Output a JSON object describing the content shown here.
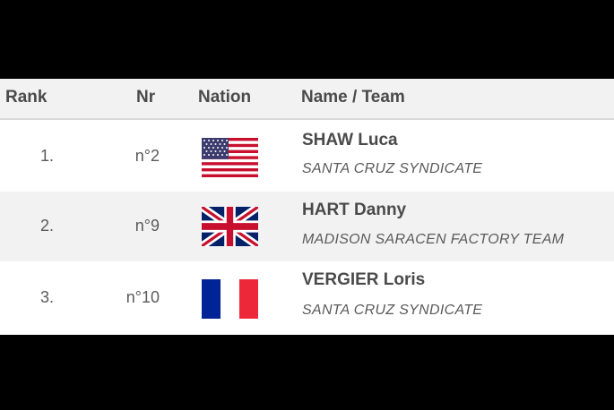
{
  "table": {
    "headers": {
      "rank": "Rank",
      "nr": "Nr",
      "nation": "Nation",
      "name_team": "Name / Team"
    },
    "rows": [
      {
        "rank": "1.",
        "nr": "n°2",
        "nation_flag": "usa-flag-icon",
        "rider": "SHAW Luca",
        "team": "SANTA CRUZ SYNDICATE"
      },
      {
        "rank": "2.",
        "nr": "n°9",
        "nation_flag": "uk-flag-icon",
        "rider": "HART Danny",
        "team": "MADISON SARACEN FACTORY TEAM"
      },
      {
        "rank": "3.",
        "nr": "n°10",
        "nation_flag": "france-flag-icon",
        "rider": "VERGIER Loris",
        "team": "SANTA CRUZ SYNDICATE"
      }
    ]
  },
  "colors": {
    "background": "#000000",
    "row_even": "#ffffff",
    "row_odd": "#f2f2f2",
    "text": "#4a4a4a"
  }
}
